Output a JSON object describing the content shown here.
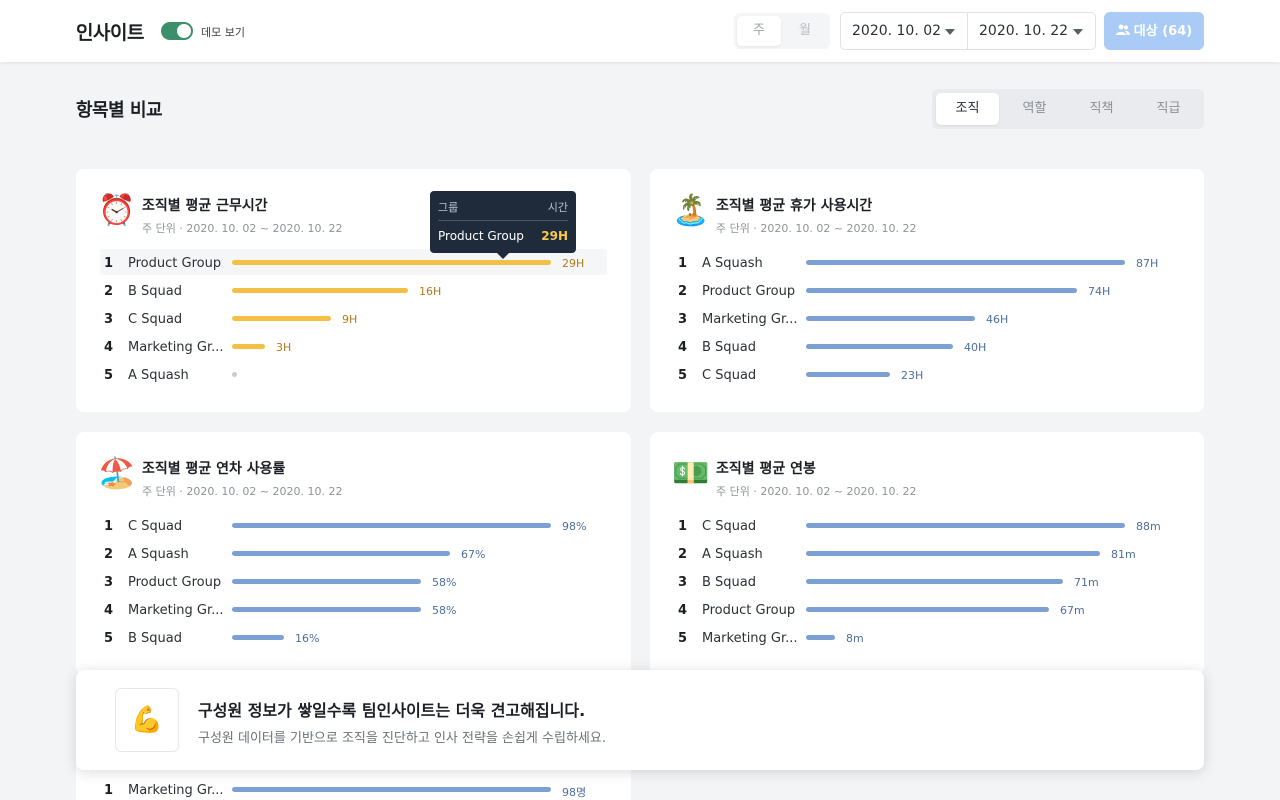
{
  "header": {
    "brand": "인사이트",
    "demo_label": "데모 보기",
    "period_tabs": [
      "주",
      "월"
    ],
    "date_start": "2020. 10. 02",
    "date_end": "2020. 10. 22",
    "target_button": "대상 (64)"
  },
  "section": {
    "title": "항목별 비교",
    "tabs": [
      "조직",
      "역할",
      "직책",
      "직급"
    ],
    "active_tab": "조직"
  },
  "cards": [
    {
      "emoji": "⏰",
      "title": "조직별 평균 근무시간",
      "subtitle": "주 단위 · 2020. 10. 02 ~ 2020. 10. 22",
      "color": "yellow",
      "max": 29,
      "rows": [
        {
          "rank": "1",
          "name": "Product Group",
          "value": 29,
          "label": "29H"
        },
        {
          "rank": "2",
          "name": "B Squad",
          "value": 16,
          "label": "16H"
        },
        {
          "rank": "3",
          "name": "C Squad",
          "value": 9,
          "label": "9H"
        },
        {
          "rank": "4",
          "name": "Marketing Gr...",
          "value": 3,
          "label": "3H"
        },
        {
          "rank": "5",
          "name": "A Squash",
          "value": 0,
          "label": ""
        }
      ]
    },
    {
      "emoji": "🏝️",
      "title": "조직별 평균 휴가 사용시간",
      "subtitle": "주 단위 · 2020. 10. 02 ~ 2020. 10. 22",
      "color": "blue",
      "max": 87,
      "rows": [
        {
          "rank": "1",
          "name": "A Squash",
          "value": 87,
          "label": "87H"
        },
        {
          "rank": "2",
          "name": "Product Group",
          "value": 74,
          "label": "74H"
        },
        {
          "rank": "3",
          "name": "Marketing Gr...",
          "value": 46,
          "label": "46H"
        },
        {
          "rank": "4",
          "name": "B Squad",
          "value": 40,
          "label": "40H"
        },
        {
          "rank": "5",
          "name": "C Squad",
          "value": 23,
          "label": "23H"
        }
      ]
    },
    {
      "emoji": "🏖️",
      "title": "조직별 평균 연차 사용률",
      "subtitle": "주 단위 · 2020. 10. 02 ~ 2020. 10. 22",
      "color": "blue",
      "max": 98,
      "rows": [
        {
          "rank": "1",
          "name": "C Squad",
          "value": 98,
          "label": "98%"
        },
        {
          "rank": "2",
          "name": "A Squash",
          "value": 67,
          "label": "67%"
        },
        {
          "rank": "3",
          "name": "Product Group",
          "value": 58,
          "label": "58%"
        },
        {
          "rank": "4",
          "name": "Marketing Gr...",
          "value": 58,
          "label": "58%"
        },
        {
          "rank": "5",
          "name": "B Squad",
          "value": 16,
          "label": "16%"
        }
      ]
    },
    {
      "emoji": "💵",
      "title": "조직별 평균 연봉",
      "subtitle": "주 단위 · 2020. 10. 02 ~ 2020. 10. 22",
      "color": "blue",
      "max": 88,
      "rows": [
        {
          "rank": "1",
          "name": "C Squad",
          "value": 88,
          "label": "88m"
        },
        {
          "rank": "2",
          "name": "A Squash",
          "value": 81,
          "label": "81m"
        },
        {
          "rank": "3",
          "name": "B Squad",
          "value": 71,
          "label": "71m"
        },
        {
          "rank": "4",
          "name": "Product Group",
          "value": 67,
          "label": "67m"
        },
        {
          "rank": "5",
          "name": "Marketing Gr...",
          "value": 8,
          "label": "8m"
        }
      ]
    },
    {
      "color": "blue",
      "max": 98,
      "rows": [
        {
          "rank": "1",
          "name": "Marketing Gr...",
          "value": 98,
          "label": "98명"
        }
      ]
    }
  ],
  "tooltip": {
    "col_group": "그룹",
    "col_time": "시간",
    "name": "Product Group",
    "value": "29H"
  },
  "banner": {
    "icon": "💪",
    "title": "구성원 정보가 쌓일수록 팀인사이트는 더욱 견고해집니다.",
    "subtitle": "구성원 데이터를 기반으로 조직을 진단하고 인사 전략을 손쉽게 수립하세요."
  },
  "colors": {
    "accent_green": "#3b8f6b",
    "bar_yellow": "#f4bf45",
    "bar_blue": "#7ca0d3",
    "button_blue": "#a9cbf5"
  }
}
